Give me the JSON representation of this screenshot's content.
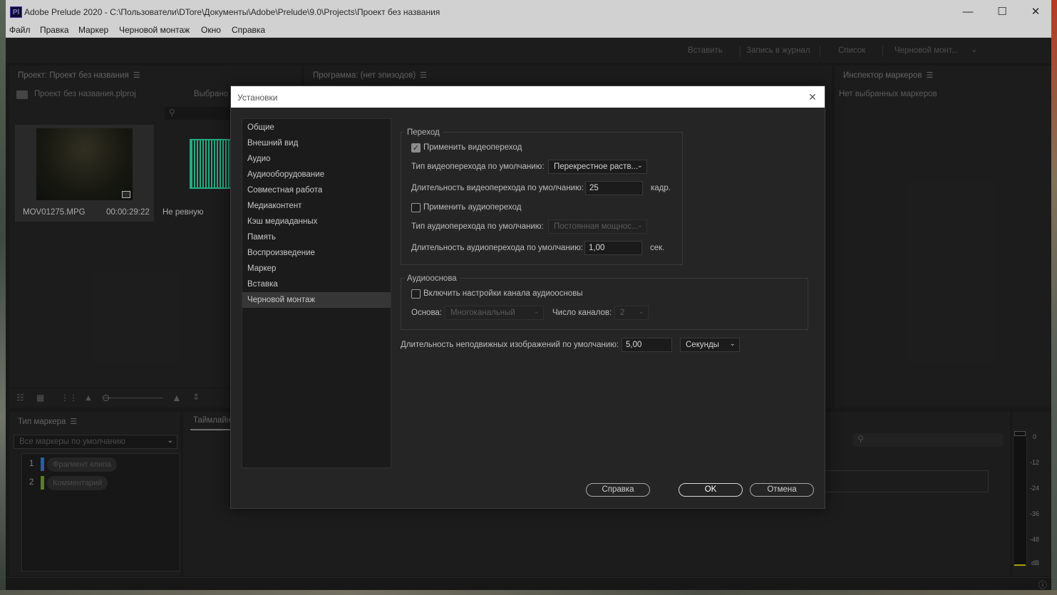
{
  "window": {
    "title": "Adobe Prelude 2020 - C:\\Пользователи\\DTore\\Документы\\Adobe\\Prelude\\9.0\\Projects\\Проект без названия",
    "logo_text": "Pl",
    "controls": {
      "minimize": "—",
      "maximize": "☐",
      "close": "✕"
    }
  },
  "menu": [
    "Файл",
    "Правка",
    "Маркер",
    "Черновой монтаж",
    "Окно",
    "Справка"
  ],
  "workspace": {
    "insert": "Вставить",
    "log": "Запись в журнал",
    "list": "Список",
    "rough_cut": "Черновой монт...",
    "caret": "⌄"
  },
  "project_panel": {
    "title": "Проект: Проект без названия",
    "file": "Проект без названия.plproj",
    "selected_label": "Выбрано (з",
    "items": [
      {
        "name": "MOV01275.MPG",
        "duration": "00:00:29:22"
      },
      {
        "name": "Не ревную"
      }
    ]
  },
  "program_panel": {
    "title": "Программа: (нет эпизодов)"
  },
  "inspector_panel": {
    "title": "Инспектор маркеров",
    "empty_text": "Нет выбранных маркеров"
  },
  "marker_type_panel": {
    "title": "Тип маркера",
    "preset": "Все маркеры по умолчанию",
    "items": [
      {
        "index": "1",
        "label": "Фрагмент клипа",
        "color": "#2f6fd4"
      },
      {
        "index": "2",
        "label": "Комментарий",
        "color": "#6f9a2a"
      }
    ]
  },
  "timeline_panel": {
    "title": "Таймлайн"
  },
  "meter": {
    "labels": [
      "0",
      "-12",
      "-24",
      "-36",
      "-48",
      "dB"
    ]
  },
  "status": {
    "info_icon": "ⓘ"
  },
  "dialog": {
    "title": "Установки",
    "close": "✕",
    "categories": [
      "Общие",
      "Внешний вид",
      "Аудио",
      "Аудиооборудование",
      "Совместная работа",
      "Медиаконтент",
      "Кэш медиаданных",
      "Память",
      "Воспроизведение",
      "Маркер",
      "Вставка",
      "Черновой монтаж"
    ],
    "selected_category": "Черновой монтаж",
    "transition": {
      "group_label": "Переход",
      "apply_video": {
        "label": "Применить видеопереход",
        "checked": true
      },
      "video_type": {
        "label": "Тип видеоперехода по умолчанию:",
        "value": "Перекрестное раств..."
      },
      "video_duration": {
        "label": "Длительность видеоперехода по умолчанию:",
        "value": "25",
        "unit": "кадр."
      },
      "apply_audio": {
        "label": "Применить аудиопереход",
        "checked": false
      },
      "audio_type": {
        "label": "Тип аудиоперехода по умолчанию:",
        "value": "Постоянная мощнос..."
      },
      "audio_duration": {
        "label": "Длительность аудиоперехода по умолчанию:",
        "value": "1,00",
        "unit": "сек."
      }
    },
    "audio_base": {
      "group_label": "Аудиооснова",
      "enable": {
        "label": "Включить настройки канала аудиоосновы",
        "checked": false
      },
      "base_label": "Основа:",
      "base_value": "Многоканальный",
      "channels_label": "Число каналов:",
      "channels_value": "2"
    },
    "still_duration": {
      "label": "Длительность неподвижных изображений по умолчанию:",
      "value": "5,00",
      "unit": "Секунды"
    },
    "buttons": {
      "help": "Справка",
      "ok": "OK",
      "cancel": "Отмена"
    }
  }
}
